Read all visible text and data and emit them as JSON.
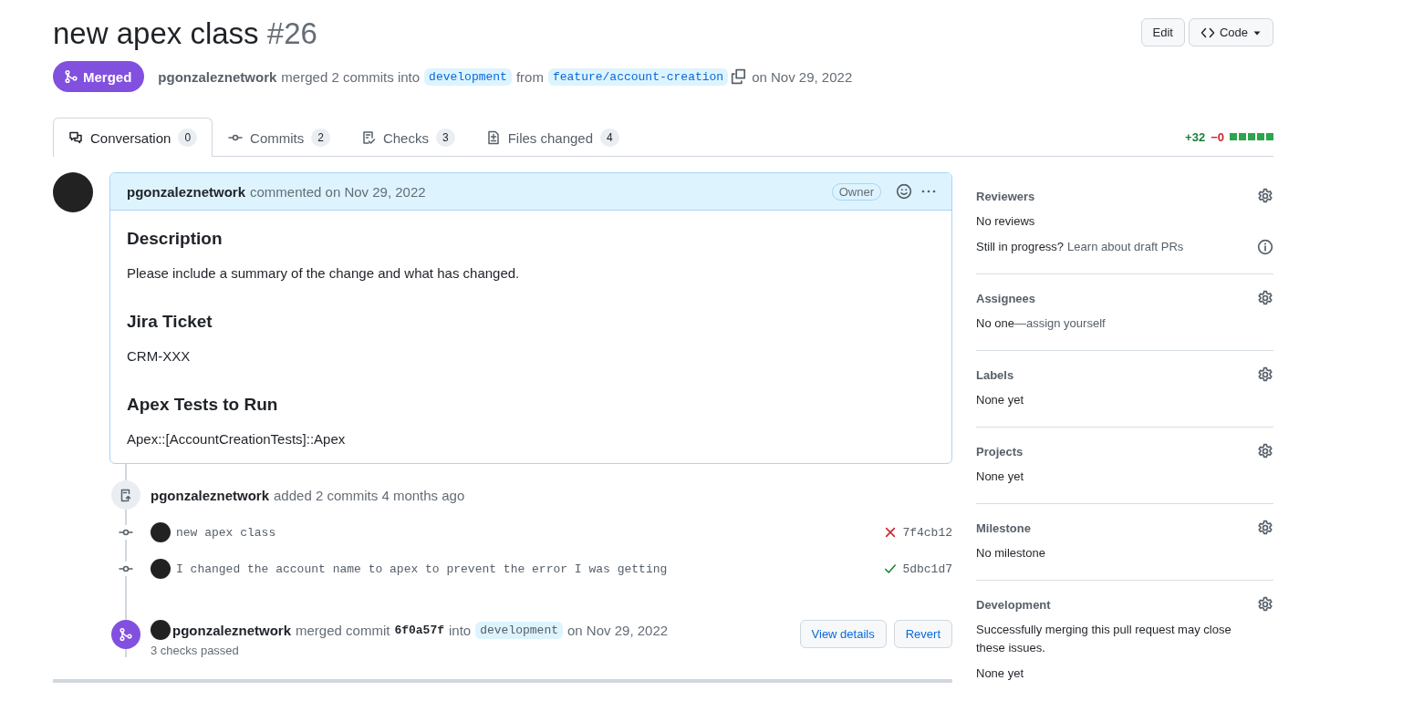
{
  "header": {
    "title": "new apex class",
    "number": "#26",
    "buttons": [
      {
        "label": "Edit",
        "kind": "plain"
      },
      {
        "label": "Code",
        "kind": "code"
      }
    ]
  },
  "status": {
    "label": "Merged",
    "merged": true
  },
  "summary": {
    "author": "pgonzaleznetwork",
    "text_1": "merged 2 commits into",
    "base_branch": "development",
    "text_2": "from",
    "head_branch": "feature/account-creation",
    "text_3": "on Nov 29, 2022"
  },
  "tabs": [
    {
      "kind": "conversation",
      "label": "Conversation",
      "count": "0",
      "selected": true
    },
    {
      "kind": "commits",
      "label": "Commits",
      "count": "2",
      "selected": false
    },
    {
      "kind": "checks",
      "label": "Checks",
      "count": "3",
      "selected": false
    },
    {
      "kind": "files",
      "label": "Files changed",
      "count": "4",
      "selected": false
    }
  ],
  "diffstat": {
    "additions": "+32",
    "deletions": "−0",
    "blocks": [
      {
        "added": true
      },
      {
        "added": true
      },
      {
        "added": true
      },
      {
        "added": true
      },
      {
        "added": true
      }
    ]
  },
  "comment": {
    "author": "pgonzaleznetwork",
    "action": "commented on Nov 29, 2022",
    "role": "Owner",
    "blocks": [
      {
        "kind": "heading",
        "text": "Description"
      },
      {
        "kind": "paragraph",
        "text": "Please include a summary of the change and what has changed."
      },
      {
        "kind": "heading",
        "text": "Jira Ticket"
      },
      {
        "kind": "paragraph",
        "text": "CRM-XXX"
      },
      {
        "kind": "heading",
        "text": "Apex Tests to Run"
      },
      {
        "kind": "paragraph",
        "text": "Apex::[AccountCreationTests]::Apex"
      }
    ]
  },
  "timeline": [
    {
      "kind": "commits",
      "author": "pgonzaleznetwork",
      "text": "added 2 commits 4 months ago",
      "commits": [
        {
          "message": "new apex class",
          "sha": "7f4cb12",
          "passed": false
        },
        {
          "message": "I changed the account name to apex to prevent the error I was getting",
          "sha": "5dbc1d7",
          "passed": true
        }
      ]
    },
    {
      "kind": "merge",
      "author": "pgonzaleznetwork",
      "text_1": "merged commit",
      "sha": "6f0a57f",
      "text_2": "into",
      "branch": "development",
      "text_3": "on Nov 29, 2022",
      "note": "3 checks passed",
      "buttons": [
        "View details",
        "Revert"
      ]
    }
  ],
  "sidebar": [
    {
      "title": "Reviewers",
      "lines": [
        {
          "kind": "plain",
          "parts": [
            {
              "text": "No reviews",
              "link": false
            }
          ]
        },
        {
          "kind": "hint",
          "parts": [
            {
              "text": "Still in progress?",
              "link": false
            },
            {
              "text": "Learn about draft PRs",
              "link": true
            }
          ]
        }
      ]
    },
    {
      "title": "Assignees",
      "lines": [
        {
          "kind": "plain",
          "parts": [
            {
              "text": "No one",
              "link": false
            },
            {
              "text": "—assign yourself",
              "link": true
            }
          ]
        }
      ]
    },
    {
      "title": "Labels",
      "lines": [
        {
          "kind": "plain",
          "parts": [
            {
              "text": "None yet",
              "link": false
            }
          ]
        }
      ]
    },
    {
      "title": "Projects",
      "lines": [
        {
          "kind": "plain",
          "parts": [
            {
              "text": "None yet",
              "link": false
            }
          ]
        }
      ]
    },
    {
      "title": "Milestone",
      "lines": [
        {
          "kind": "plain",
          "parts": [
            {
              "text": "No milestone",
              "link": false
            }
          ]
        }
      ]
    },
    {
      "title": "Development",
      "lines": [
        {
          "kind": "plain",
          "parts": [
            {
              "text": "Successfully merging this pull request may close these issues.",
              "link": false
            }
          ]
        },
        {
          "kind": "plain",
          "parts": [
            {
              "text": "None yet",
              "link": false
            }
          ]
        }
      ]
    }
  ]
}
